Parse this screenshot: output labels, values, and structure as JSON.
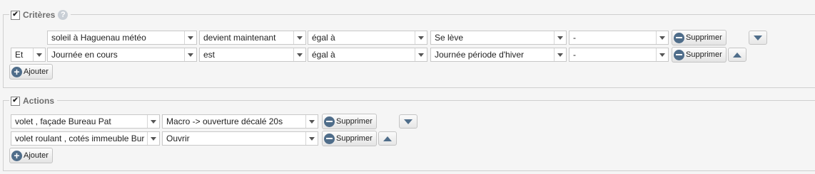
{
  "criteria": {
    "legend": "Critères",
    "checked": true,
    "help_icon": "question-circle-icon",
    "rows": [
      {
        "connector": null,
        "subject": "soleil à Haguenau météo",
        "operator": "devient maintenant",
        "comparison": "égal à",
        "value": "Se lève",
        "extra": "-",
        "delete_label": "Supprimer",
        "move": "down"
      },
      {
        "connector": "Et",
        "subject": "Journée en cours",
        "operator": "est",
        "comparison": "égal à",
        "value": "Journée période d'hiver",
        "extra": "-",
        "delete_label": "Supprimer",
        "move": "up"
      }
    ],
    "add_label": "Ajouter"
  },
  "actions": {
    "legend": "Actions",
    "checked": true,
    "rows": [
      {
        "device": "volet , façade Bureau Pat",
        "command": "Macro -> ouverture décalé 20s",
        "delete_label": "Supprimer",
        "move": "down"
      },
      {
        "device": "volet roulant , cotés immeuble Bur",
        "command": "Ouvrir",
        "delete_label": "Supprimer",
        "move": "up"
      }
    ],
    "add_label": "Ajouter"
  },
  "colors": {
    "background": "#f5f5f5",
    "icon_blue": "#4f6d8a",
    "border": "#c8c8c8"
  }
}
